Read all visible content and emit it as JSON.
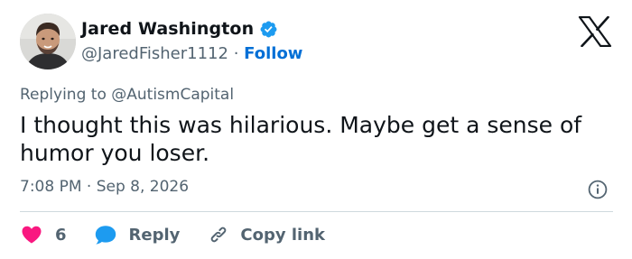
{
  "author": {
    "display_name": "Jared Washington",
    "handle": "@JaredFisher1112",
    "separator": "·",
    "follow_label": "Follow",
    "verified": true
  },
  "brand": {
    "logo_icon": "x-logo-icon"
  },
  "tweet": {
    "replying_to_label": "Replying to",
    "replying_to_handle": "@AutismCapital",
    "text": "I thought this was hilarious. Maybe get a sense of humor you loser.",
    "time": "7:08 PM",
    "separator": "·",
    "date": "Sep 8, 2026"
  },
  "actions": {
    "like_count": "6",
    "reply_label": "Reply",
    "copy_link_label": "Copy link"
  },
  "colors": {
    "link_blue": "#006fd6",
    "verified_blue": "#1d9bf0",
    "like_pink": "#f91880",
    "text_primary": "#0f1419",
    "text_secondary": "#536471",
    "divider": "#cfd9de"
  }
}
